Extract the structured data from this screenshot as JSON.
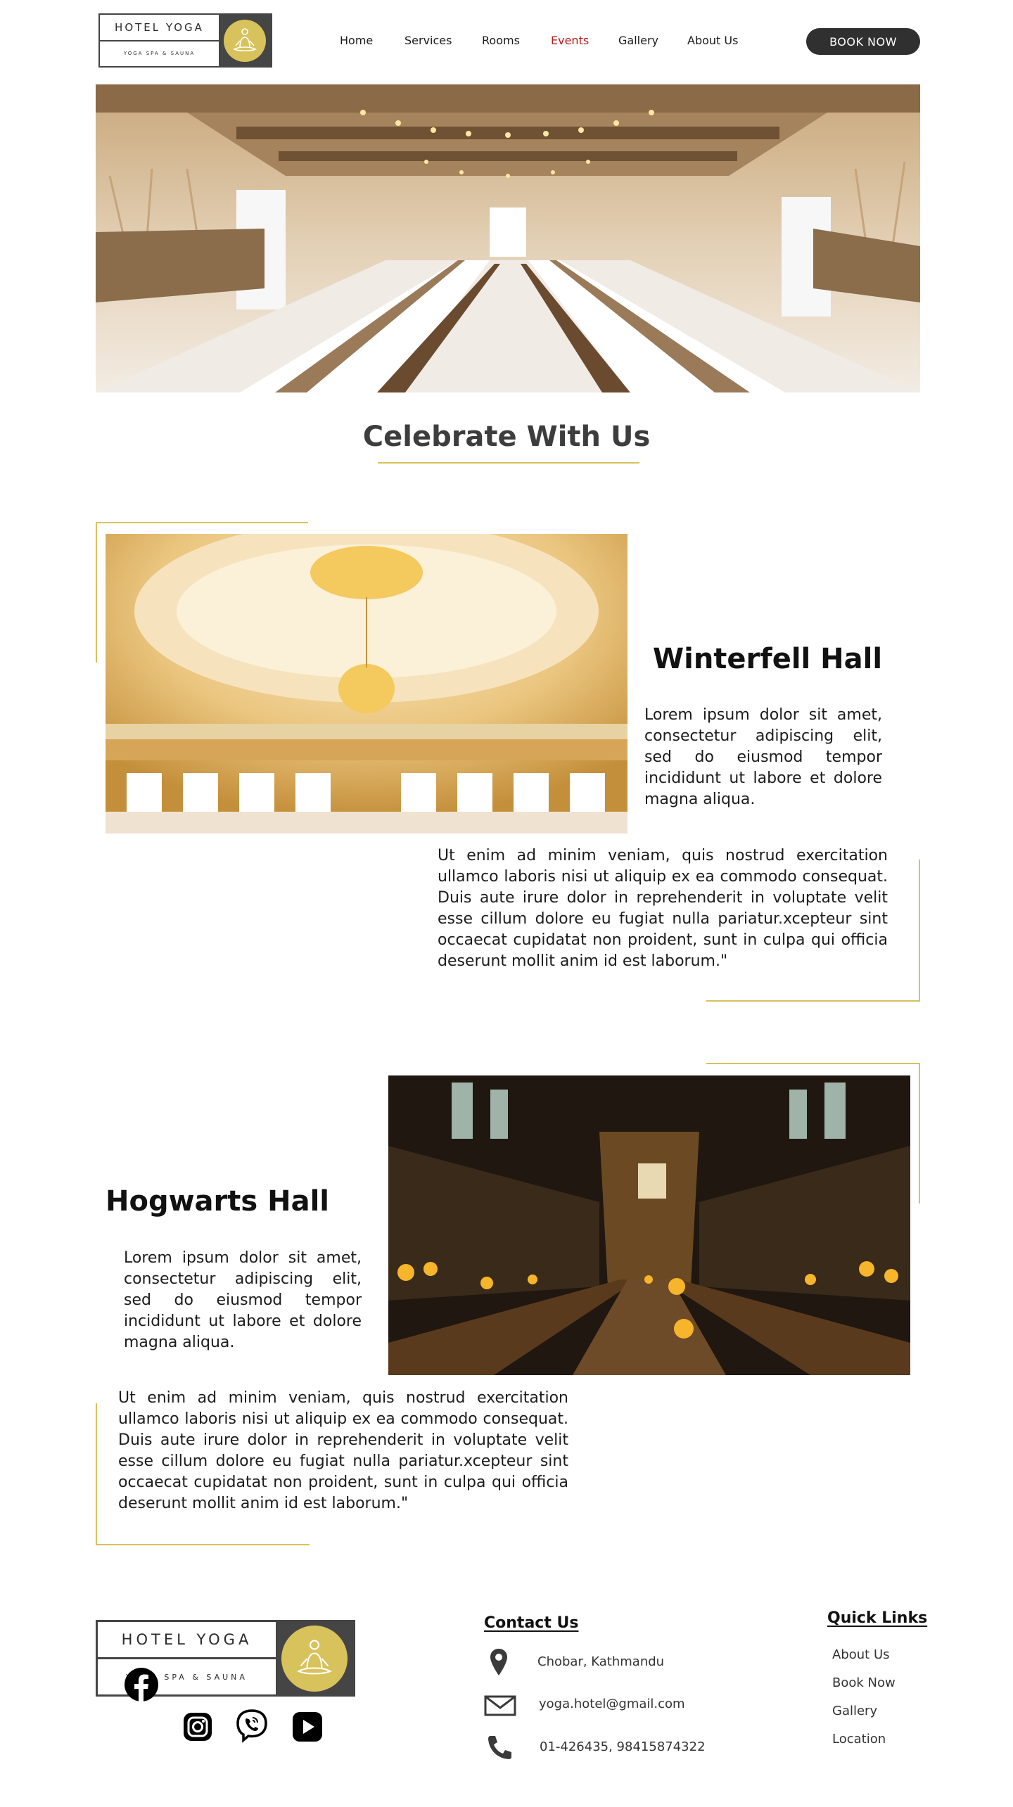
{
  "brand": {
    "name": "HOTEL YOGA",
    "tagline": "YOGA SPA & SAUNA",
    "gold": "#d8c25c",
    "dark": "#454545"
  },
  "nav": {
    "items": [
      {
        "label": "Home",
        "active": false
      },
      {
        "label": "Services",
        "active": false
      },
      {
        "label": "Rooms",
        "active": false
      },
      {
        "label": "Events",
        "active": true
      },
      {
        "label": "Gallery",
        "active": false
      },
      {
        "label": "About Us",
        "active": false
      }
    ],
    "book_label": "BOOK NOW",
    "active_color": "#b71c1c"
  },
  "page": {
    "title": "Celebrate With Us"
  },
  "halls": [
    {
      "name": "Winterfell Hall",
      "intro": "Lorem ipsum dolor sit amet, consectetur adipiscing elit, sed do eiusmod tempor incididunt ut labore et dolore magna aliqua.",
      "body": "Ut enim ad minim veniam, quis nostrud exercitation ullamco laboris nisi ut aliquip ex ea commodo consequat. Duis aute irure dolor in reprehenderit in voluptate velit esse cillum dolore eu fugiat nulla pariatur.xcepteur sint occaecat cupidatat non proident, sunt in culpa qui officia deserunt mollit anim id est laborum.\""
    },
    {
      "name": "Hogwarts Hall",
      "intro": "Lorem ipsum dolor sit amet, consectetur adipiscing elit, sed do eiusmod tempor incididunt ut labore et dolore magna aliqua.",
      "body": "Ut enim ad minim veniam, quis nostrud exercitation ullamco laboris nisi ut aliquip ex ea commodo consequat. Duis aute irure dolor in reprehenderit in voluptate velit esse cillum dolore eu fugiat nulla pariatur.xcepteur sint occaecat cupidatat non proident, sunt in culpa qui officia deserunt mollit anim id est laborum.\""
    }
  ],
  "footer": {
    "social": [
      "facebook-icon",
      "instagram-icon",
      "viber-icon",
      "youtube-icon"
    ],
    "contact": {
      "heading": "Contact Us",
      "address": "Chobar, Kathmandu",
      "email": "yoga.hotel@gmail.com",
      "phone": "01-426435, 98415874322"
    },
    "quick_links": {
      "heading": "Quick Links",
      "items": [
        "About Us",
        "Book Now",
        "Gallery",
        "Location"
      ]
    }
  }
}
